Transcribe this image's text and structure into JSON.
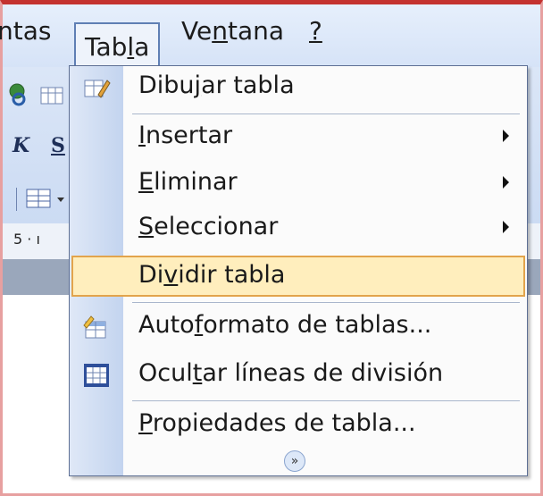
{
  "menubar": {
    "items": [
      {
        "label_pre": "ntas",
        "label_u": "",
        "label_post": ""
      },
      {
        "label_pre": "Tab",
        "label_u": "l",
        "label_post": "a"
      },
      {
        "label_pre": "Ve",
        "label_u": "n",
        "label_post": "tana"
      },
      {
        "label_pre": "",
        "label_u": "?",
        "label_post": ""
      }
    ]
  },
  "toolbar": {
    "bold_glyph": "K",
    "underline_glyph": "S",
    "ruler_text": "5 · ı"
  },
  "menu": {
    "items": [
      {
        "pre": "Dibu",
        "u": "j",
        "post": "ar tabla"
      },
      {
        "pre": "",
        "u": "I",
        "post": "nsertar"
      },
      {
        "pre": "",
        "u": "E",
        "post": "liminar"
      },
      {
        "pre": "",
        "u": "S",
        "post": "eleccionar"
      },
      {
        "pre": "Di",
        "u": "v",
        "post": "idir tabla"
      },
      {
        "pre": "Auto",
        "u": "f",
        "post": "ormato de tablas..."
      },
      {
        "pre": "Ocul",
        "u": "t",
        "post": "ar líneas de división"
      },
      {
        "pre": "",
        "u": "P",
        "post": "ropiedades de tabla..."
      }
    ],
    "expand_glyph": "»"
  },
  "colors": {
    "highlight_bg": "#ffeebd",
    "highlight_border": "#e2a44c",
    "menu_border": "#5d6f94"
  }
}
